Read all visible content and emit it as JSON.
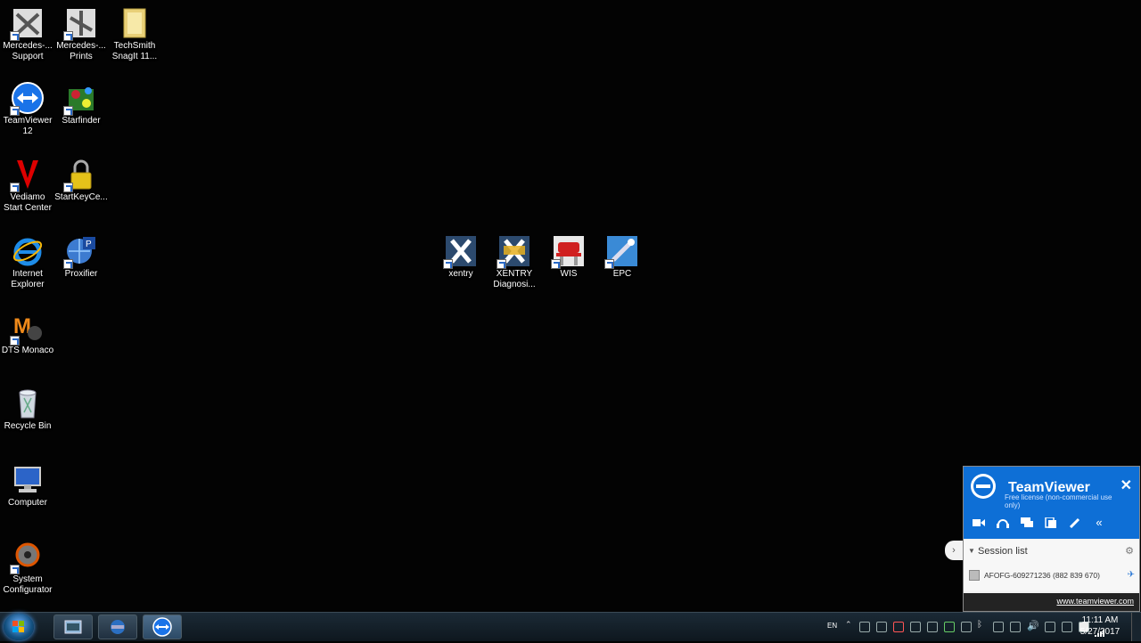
{
  "desktop": {
    "left_icons": [
      {
        "label": "Mercedes-...\nSupport"
      },
      {
        "label": "Mercedes-...\nPrints"
      },
      {
        "label": "TechSmith\nSnagIt 11..."
      },
      {
        "label": "TeamViewer\n12"
      },
      {
        "label": "Starfinder"
      },
      {
        "label": "Vediamo\nStart Center"
      },
      {
        "label": "StartKeyCe..."
      },
      {
        "label": "Internet\nExplorer"
      },
      {
        "label": "Proxifier"
      },
      {
        "label": "DTS Monaco"
      },
      {
        "label": "Recycle Bin"
      },
      {
        "label": "Computer"
      },
      {
        "label": "System\nConfigurator"
      }
    ],
    "center_icons": [
      {
        "label": "xentry"
      },
      {
        "label": "XENTRY\nDiagnosi..."
      },
      {
        "label": "WIS"
      },
      {
        "label": "EPC"
      }
    ]
  },
  "teamviewer": {
    "title": "TeamViewer",
    "license": "Free license (non-commercial use only)",
    "close": "✕",
    "session_title": "Session list",
    "session_id": "AFOFG-609271236 (882 839 670)",
    "link": "www.teamviewer.com",
    "tools": [
      "video-icon",
      "headset-icon",
      "chat-icon",
      "files-icon",
      "pen-icon",
      "collapse-icon"
    ]
  },
  "taskbar": {
    "lang": "EN",
    "time": "11:11 AM",
    "date": "5/27/2017"
  }
}
